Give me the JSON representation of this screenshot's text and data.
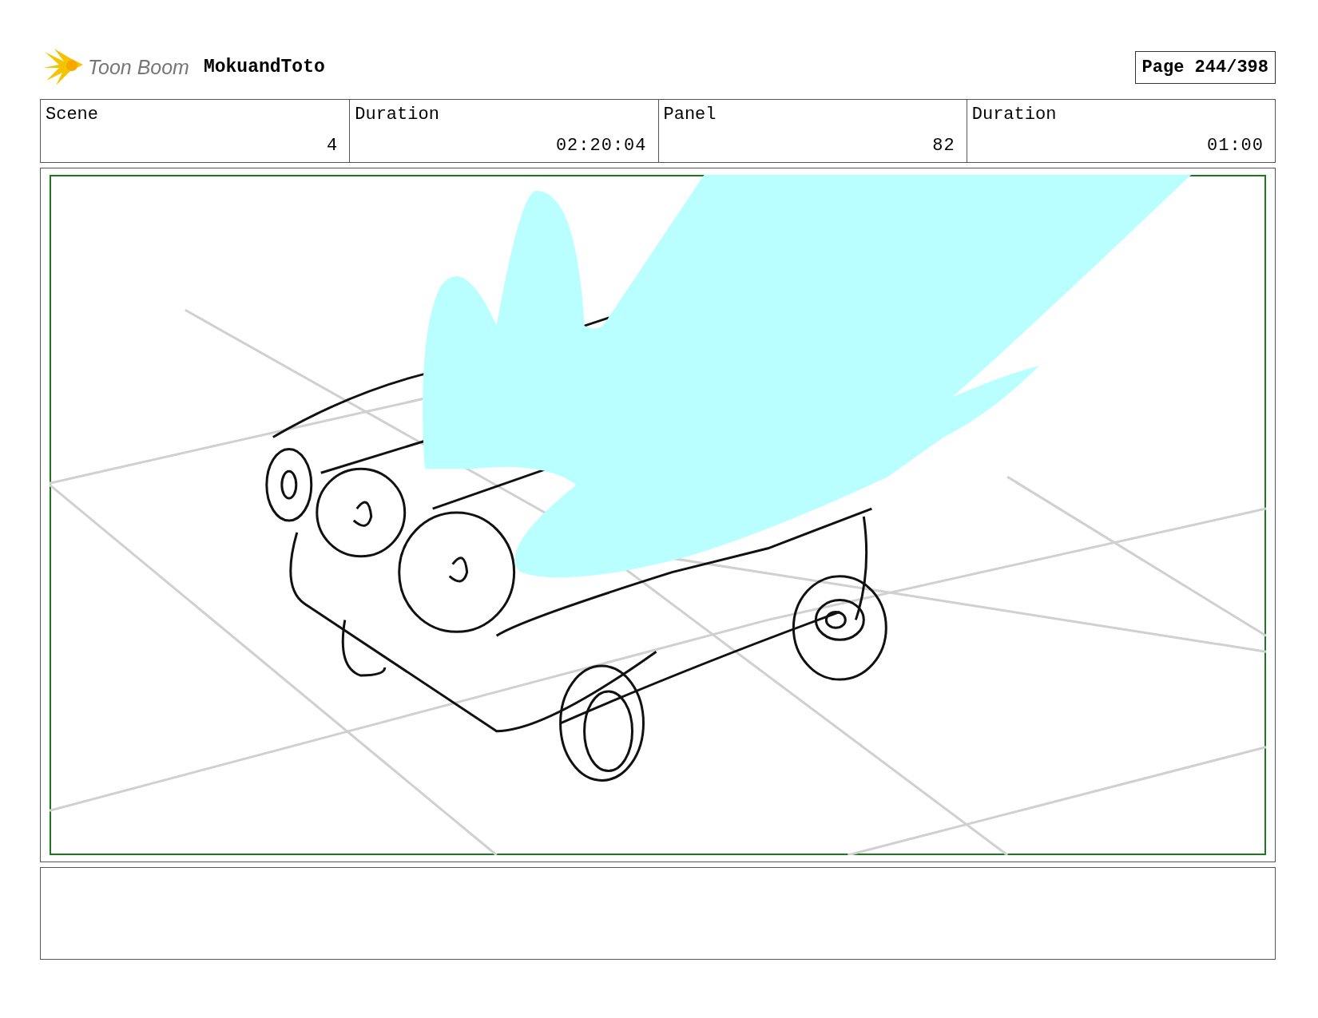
{
  "header": {
    "logo_text": "Toon Boom",
    "project": "MokuandToto",
    "page": "Page 244/398"
  },
  "info": [
    {
      "label": "Scene",
      "value": "4"
    },
    {
      "label": "Duration",
      "value": "02:20:04"
    },
    {
      "label": "Panel",
      "value": "82"
    },
    {
      "label": "Duration",
      "value": "01:00"
    }
  ]
}
